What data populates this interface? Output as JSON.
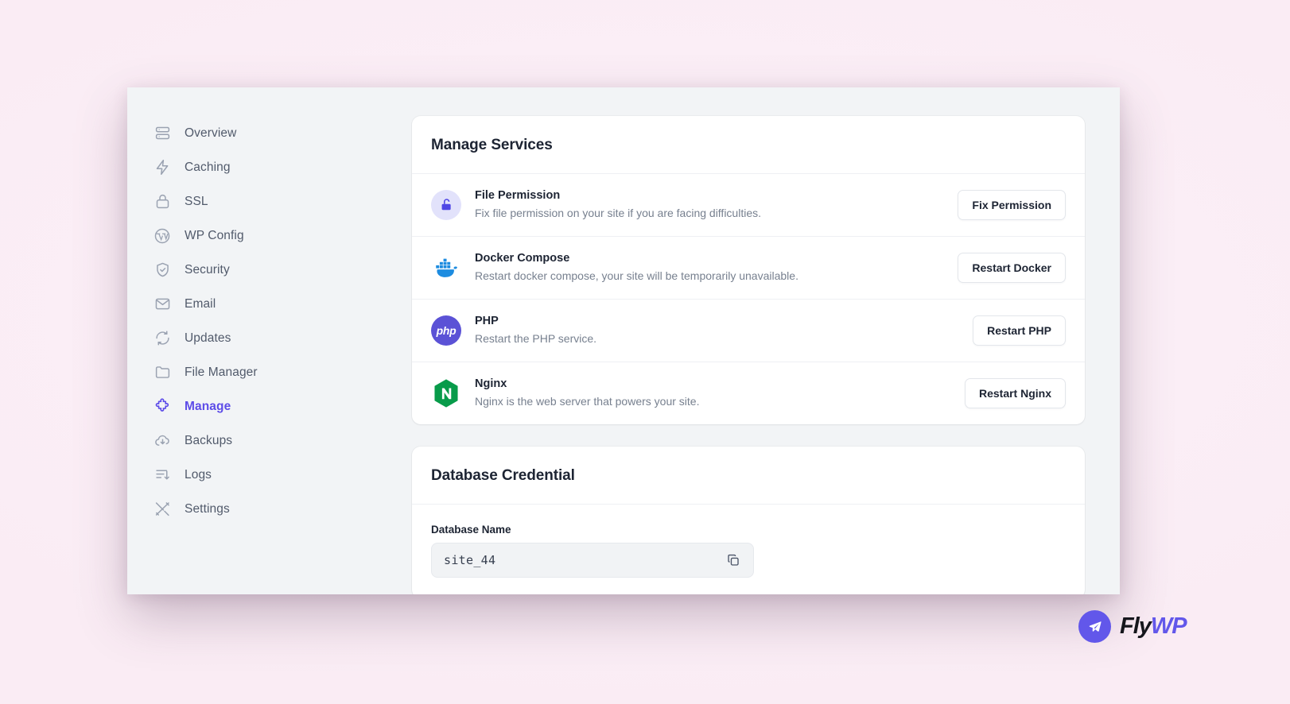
{
  "colors": {
    "accent": "#5d4ce8",
    "page_background": "#fbf1f7",
    "panel_background": "#f2f4f6",
    "card_background": "#ffffff",
    "text_primary": "#1d2433",
    "text_muted": "#77808f",
    "docker_blue": "#2396ed",
    "php_purple": "#5b52d6",
    "nginx_green": "#089b4a"
  },
  "sidebar": {
    "items": [
      {
        "label": "Overview",
        "icon": "server-icon",
        "active": false
      },
      {
        "label": "Caching",
        "icon": "bolt-icon",
        "active": false
      },
      {
        "label": "SSL",
        "icon": "lock-icon",
        "active": false
      },
      {
        "label": "WP Config",
        "icon": "wordpress-icon",
        "active": false
      },
      {
        "label": "Security",
        "icon": "shield-check-icon",
        "active": false
      },
      {
        "label": "Email",
        "icon": "envelope-icon",
        "active": false
      },
      {
        "label": "Updates",
        "icon": "refresh-icon",
        "active": false
      },
      {
        "label": "File Manager",
        "icon": "folder-icon",
        "active": false
      },
      {
        "label": "Manage",
        "icon": "puzzle-icon",
        "active": true
      },
      {
        "label": "Backups",
        "icon": "cloud-download-icon",
        "active": false
      },
      {
        "label": "Logs",
        "icon": "logs-icon",
        "active": false
      },
      {
        "label": "Settings",
        "icon": "tools-icon",
        "active": false
      }
    ]
  },
  "manage_services": {
    "title": "Manage Services",
    "rows": [
      {
        "name": "File Permission",
        "description": "Fix file permission on your site if you are facing difficulties.",
        "icon": "unlock-icon",
        "button": "Fix Permission"
      },
      {
        "name": "Docker Compose",
        "description": "Restart docker compose, your site will be temporarily unavailable.",
        "icon": "docker-icon",
        "button": "Restart Docker"
      },
      {
        "name": "PHP",
        "description": "Restart the PHP service.",
        "icon": "php-icon",
        "button": "Restart PHP"
      },
      {
        "name": "Nginx",
        "description": "Nginx is the web server that powers your site.",
        "icon": "nginx-icon",
        "button": "Restart Nginx"
      }
    ]
  },
  "database_credential": {
    "title": "Database Credential",
    "fields": [
      {
        "label": "Database Name",
        "value": "site_44",
        "copy_icon": "copy-icon"
      }
    ]
  },
  "brand": {
    "mark_icon": "paper-plane-icon",
    "name_first": "Fly",
    "name_second": "WP"
  }
}
